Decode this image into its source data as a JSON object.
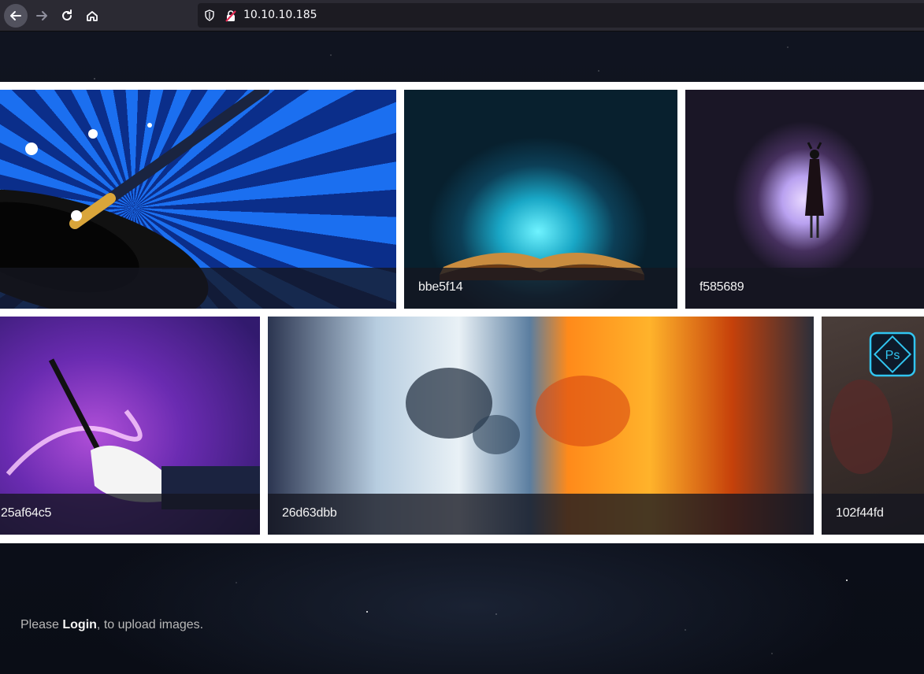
{
  "browser": {
    "url": "10.10.10.185",
    "icons": [
      "back-arrow-icon",
      "forward-arrow-icon",
      "reload-icon",
      "home-icon",
      "shield-icon",
      "insecure-lock-icon"
    ]
  },
  "gallery": {
    "images": [
      {
        "caption": ""
      },
      {
        "caption": "bbe5f14"
      },
      {
        "caption": "f585689"
      },
      {
        "caption": "25af64c5"
      },
      {
        "caption": "26d63dbb"
      },
      {
        "caption": "102f44fd",
        "badge": "Ps"
      }
    ]
  },
  "footer": {
    "prefix": "Please ",
    "login_link": "Login",
    "suffix": ", to upload images."
  },
  "colors": {
    "badge_accent": "#31c5f0",
    "toolbar_bg": "#2b2a33"
  }
}
